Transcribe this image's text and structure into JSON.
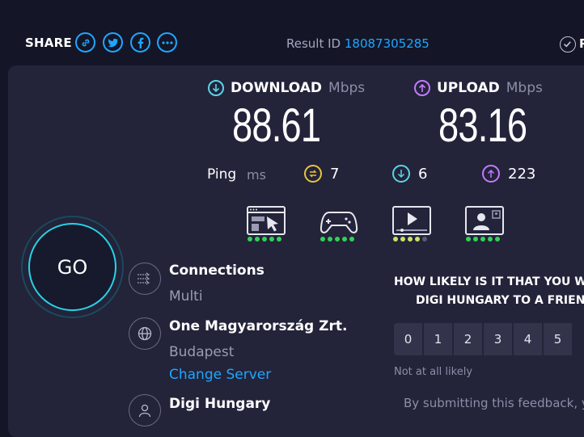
{
  "header": {
    "share_label": "SHARE",
    "share_buttons": [
      {
        "icon": "link-icon"
      },
      {
        "icon": "twitter-icon"
      },
      {
        "icon": "facebook-icon"
      },
      {
        "icon": "more-icon"
      }
    ],
    "result_label": "Result ID",
    "result_id": "18087305285",
    "trailing_letter": "R"
  },
  "download": {
    "label": "DOWNLOAD",
    "unit": "Mbps",
    "value": "88.61",
    "icon_color": "#5ad4e6"
  },
  "upload": {
    "label": "UPLOAD",
    "unit": "Mbps",
    "value": "83.16",
    "icon_color": "#c27bff"
  },
  "ping": {
    "label": "Ping",
    "unit": "ms",
    "idle": "7",
    "download": "6",
    "upload": "223",
    "colors": {
      "idle": "#e8c53a",
      "download": "#5ad4e6",
      "upload": "#c27bff"
    }
  },
  "categories": [
    {
      "icon": "web-browsing-icon",
      "rating": 5
    },
    {
      "icon": "gaming-icon",
      "rating": 5
    },
    {
      "icon": "video-streaming-icon",
      "rating": 4
    },
    {
      "icon": "video-chat-icon",
      "rating": 5
    }
  ],
  "go_button": {
    "label": "GO"
  },
  "connections": {
    "title": "Connections",
    "value": "Multi"
  },
  "server": {
    "title": "One Magyarország Zrt.",
    "location": "Budapest",
    "change_label": "Change Server"
  },
  "provider": {
    "title": "Digi Hungary"
  },
  "survey": {
    "question_line1": "HOW LIKELY IS IT THAT YOU W",
    "question_line2": "DIGI HUNGARY TO A FRIEN",
    "scale": [
      "0",
      "1",
      "2",
      "3",
      "4",
      "5"
    ],
    "low_label": "Not at all likely",
    "submit_note": "By submitting this feedback, y"
  }
}
